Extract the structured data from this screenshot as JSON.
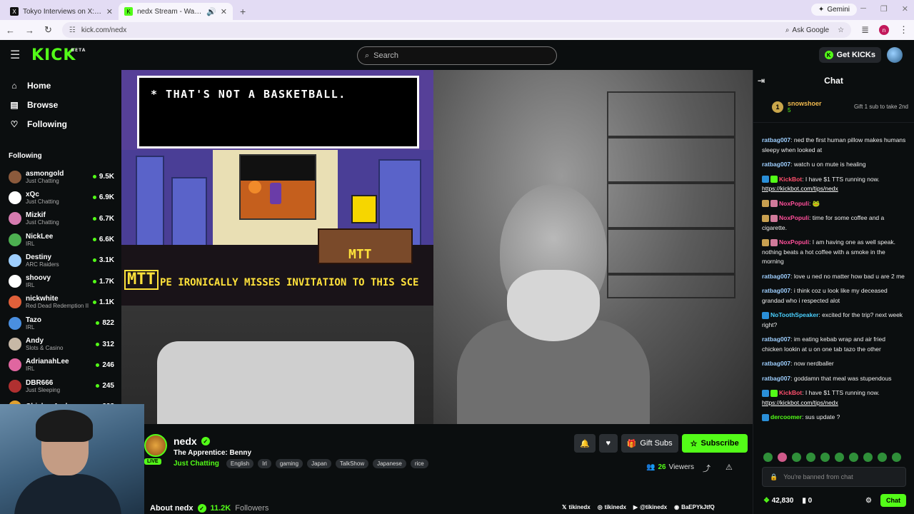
{
  "browser": {
    "tabs": [
      {
        "favicon": "X",
        "title": "Tokyo Interviews on X: \"@callis",
        "active": false
      },
      {
        "favicon": "K",
        "title": "nedx Stream - Watch Live o",
        "active": true
      }
    ],
    "gemini_label": "Gemini",
    "url": "kick.com/nedx",
    "ask_google": "Ask Google",
    "profile_initial": "n"
  },
  "topbar": {
    "logo": "KICK",
    "logo_sup": "BETA",
    "search_placeholder": "Search",
    "get_kicks": "Get KICKs"
  },
  "sidebar": {
    "nav": [
      {
        "icon": "home-icon",
        "label": "Home"
      },
      {
        "icon": "browse-icon",
        "label": "Browse"
      },
      {
        "icon": "heart-icon",
        "label": "Following"
      }
    ],
    "following_title": "Following",
    "following": [
      {
        "name": "asmongold",
        "category": "Just Chatting",
        "viewers": "9.5K",
        "color": "#8b5a3c"
      },
      {
        "name": "xQc",
        "category": "Just Chatting",
        "viewers": "6.9K",
        "color": "#ffffff"
      },
      {
        "name": "Mizkif",
        "category": "Just Chatting",
        "viewers": "6.7K",
        "color": "#d67bb0"
      },
      {
        "name": "NickLee",
        "category": "IRL",
        "viewers": "6.6K",
        "color": "#4caf50"
      },
      {
        "name": "Destiny",
        "category": "ARC Raiders",
        "viewers": "3.1K",
        "color": "#9ecfff"
      },
      {
        "name": "shoovy",
        "category": "IRL",
        "viewers": "1.7K",
        "color": "#ffffff"
      },
      {
        "name": "nickwhite",
        "category": "Red Dead Redemption II",
        "viewers": "1.1K",
        "color": "#e0603a"
      },
      {
        "name": "Tazo",
        "category": "IRL",
        "viewers": "822",
        "color": "#4a8fe0"
      },
      {
        "name": "Andy",
        "category": "Slots & Casino",
        "viewers": "312",
        "color": "#c7b8a6"
      },
      {
        "name": "AdrianahLee",
        "category": "IRL",
        "viewers": "246",
        "color": "#e066a0"
      },
      {
        "name": "DBR666",
        "category": "Just Sleeping",
        "viewers": "245",
        "color": "#b03030"
      },
      {
        "name": "ChickenAndy",
        "category": "",
        "viewers": "228",
        "color": "#e0a030"
      }
    ]
  },
  "game": {
    "dialog": "* THAT'S NOT A BASKETBALL.",
    "desk_label": "MTT",
    "logo": "MTT",
    "ticker": "PE IRONICALLY MISSES INVITATION TO THIS SCE"
  },
  "channel": {
    "name": "nedx",
    "live": "LIVE",
    "title": "The Apprentice: Benny",
    "category": "Just Chatting",
    "tags": [
      "English",
      "Irl",
      "gaming",
      "Japan",
      "TalkShow",
      "Japanese",
      "rice"
    ],
    "gift_subs": "Gift Subs",
    "subscribe": "Subscribe",
    "viewers_count": "26",
    "viewers_label": "Viewers",
    "about_label": "About nedx",
    "followers_count": "11.2K",
    "followers_label": "Followers",
    "socials": [
      {
        "icon": "x-icon",
        "handle": "tikinedx"
      },
      {
        "icon": "instagram-icon",
        "handle": "tikinedx"
      },
      {
        "icon": "youtube-icon",
        "handle": "@tikinedx"
      },
      {
        "icon": "discord-icon",
        "handle": "BaEPYkJtfQ"
      }
    ]
  },
  "chat": {
    "title": "Chat",
    "pinned": {
      "rank": "1",
      "user": "snowshoer",
      "count": "5",
      "gift_text": "Gift 1 sub to take 2nd"
    },
    "messages": [
      {
        "user": "ratbag007",
        "color": "#9ecfff",
        "text": "ned the first human pillow makes humans sleepy when looked at",
        "badges": []
      },
      {
        "user": "ratbag007",
        "color": "#9ecfff",
        "text": "watch u on mute is healing",
        "badges": []
      },
      {
        "user": "KickBot",
        "color": "#ff4f6d",
        "text": "I have $1 TTS running now.",
        "link": "https://kickbot.com/tips/nedx",
        "badges": [
          "#2a8fd8",
          "#53fc18"
        ]
      },
      {
        "user": "NoxPopuli",
        "color": "#ff4f9a",
        "text": "🐸",
        "badges": [
          "#c8a050",
          "#d07a9a"
        ]
      },
      {
        "user": "NoxPopuli",
        "color": "#ff4f9a",
        "text": "time for some coffee and a cigarette.",
        "badges": [
          "#c8a050",
          "#d07a9a"
        ]
      },
      {
        "user": "NoxPopuli",
        "color": "#ff4f9a",
        "text": "I am having one as well speak. nothing beats a hot coffee with a smoke in the morning",
        "badges": [
          "#c8a050",
          "#d07a9a"
        ]
      },
      {
        "user": "ratbag007",
        "color": "#9ecfff",
        "text": "love u ned no matter how bad u are 2 me",
        "badges": []
      },
      {
        "user": "ratbag007",
        "color": "#9ecfff",
        "text": "i think coz u look like my deceased grandad who i respected alot",
        "badges": []
      },
      {
        "user": "NoToothSpeaker",
        "color": "#4ad0ff",
        "text": "excited for the trip? next week right?",
        "badges": [
          "#2a8fd8"
        ]
      },
      {
        "user": "ratbag007",
        "color": "#9ecfff",
        "text": "im eating kebab wrap and air fried chicken lookin at u on one tab tazo the other",
        "badges": []
      },
      {
        "user": "ratbag007",
        "color": "#9ecfff",
        "text": "now nerdballer",
        "badges": []
      },
      {
        "user": "ratbag007",
        "color": "#9ecfff",
        "text": "goddamn that meal was stupendous",
        "badges": []
      },
      {
        "user": "KickBot",
        "color": "#ff4f6d",
        "text": "I have $1 TTS running now.",
        "link": "https://kickbot.com/tips/nedx",
        "badges": [
          "#2a8fd8",
          "#53fc18"
        ]
      },
      {
        "user": "dercoomer",
        "color": "#53fc18",
        "text": "sus update ?",
        "badges": [
          "#2a8fd8"
        ]
      }
    ],
    "input_placeholder": "You're banned from chat",
    "kicks_balance": "42,830",
    "points": "0",
    "chat_button": "Chat"
  }
}
